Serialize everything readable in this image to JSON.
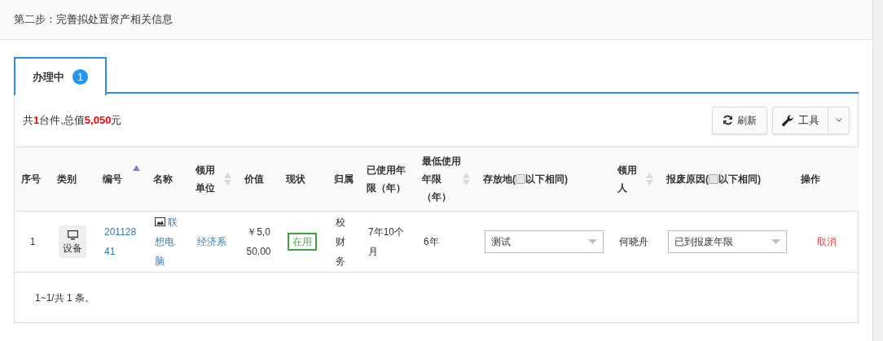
{
  "step_title": "第二步：完善拟处置资产相关信息",
  "tabs": [
    {
      "label": "办理中",
      "badge": "1",
      "selected": true
    }
  ],
  "summary": "共**1**台件,总值**5,050**元",
  "toolbar": {
    "refresh": "刷新",
    "tools": "工具"
  },
  "table": {
    "columns": [
      {
        "kind": "text",
        "label": "序号"
      },
      {
        "kind": "text",
        "label": "类别"
      },
      {
        "kind": "text",
        "label": "编号",
        "sorted": true
      },
      {
        "kind": "text",
        "label": "名称"
      },
      {
        "kind": "text",
        "label": "领用单位",
        "sorted": false
      },
      {
        "kind": "text",
        "label": "价值"
      },
      {
        "kind": "text",
        "label": "现状"
      },
      {
        "kind": "text",
        "label": "归属"
      },
      {
        "kind": "text",
        "label": "已使用年限（年）"
      },
      {
        "kind": "text",
        "label": "最低使用年限（年）",
        "sorted": false
      },
      {
        "kind": "checkbox",
        "label": "存放地(",
        "after": "以下相同)",
        "checked": false
      },
      {
        "kind": "text",
        "label": "领用人",
        "sorted": false
      },
      {
        "kind": "checkbox",
        "label": "报废原因(",
        "after": "以下相同)",
        "checked": false
      },
      {
        "kind": "text",
        "label": "操作"
      }
    ],
    "rows": [
      [
        {
          "kind": "number",
          "text": "1"
        },
        {
          "kind": "category",
          "text": "设备"
        },
        {
          "kind": "link",
          "text": "20112841"
        },
        {
          "kind": "image-link",
          "text": "联想电脑"
        },
        {
          "kind": "link",
          "text": "经济系"
        },
        {
          "kind": "money",
          "text": "￥5,050.00"
        },
        {
          "kind": "status",
          "text": "在用"
        },
        {
          "kind": "text",
          "text": "校财务"
        },
        {
          "kind": "text",
          "text": "7年10个月"
        },
        {
          "kind": "text",
          "text": "6年"
        },
        {
          "kind": "select",
          "text": "测试"
        },
        {
          "kind": "text",
          "text": "何晓舟"
        },
        {
          "kind": "select",
          "text": "已到报废年限"
        },
        {
          "kind": "action",
          "text": "取消"
        }
      ]
    ]
  },
  "footer": "1~1/共 1 条。"
}
